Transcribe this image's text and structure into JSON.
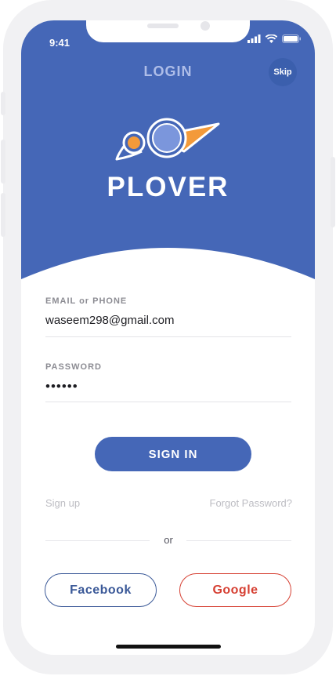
{
  "status_bar": {
    "time": "9:41"
  },
  "header": {
    "title": "LOGIN",
    "skip_label": "Skip"
  },
  "brand": {
    "name": "PLOVER"
  },
  "form": {
    "email": {
      "label": "EMAIL or PHONE",
      "value": "waseem298@gmail.com"
    },
    "password": {
      "label": "PASSWORD",
      "value": "••••••"
    },
    "submit_label": "SIGN IN"
  },
  "links": {
    "sign_up": "Sign up",
    "forgot_password": "Forgot Password?"
  },
  "divider": {
    "text": "or"
  },
  "social": {
    "facebook_label": "Facebook",
    "google_label": "Google"
  },
  "colors": {
    "primary": "#4567b7",
    "logo_orange": "#f39a3a",
    "logo_blue": "#7b96dc",
    "facebook": "#3b5998",
    "google": "#d64033"
  }
}
